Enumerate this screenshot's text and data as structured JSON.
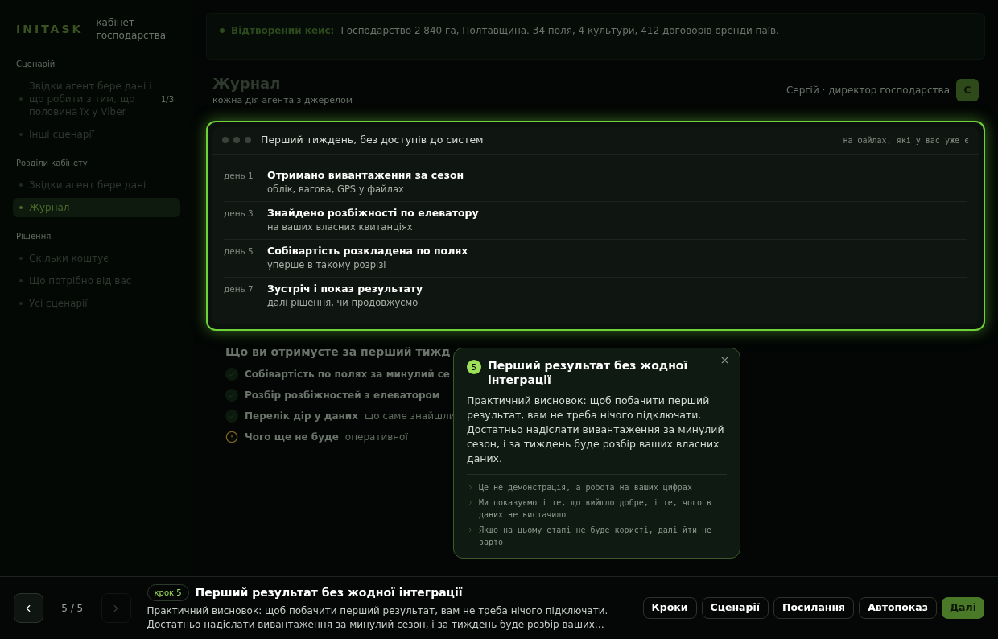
{
  "sidebar": {
    "logo": "INITASK",
    "subtitle": "кабінет господарства",
    "sections": [
      {
        "title": "Сценарій",
        "items": [
          {
            "label": "Звідки агент бере дані і що робити з тим, що половина їх у Viber",
            "count": "1/3",
            "selected": false
          },
          {
            "label": "Інші сценарії",
            "selected": false
          }
        ]
      },
      {
        "title": "Розділи кабінету",
        "items": [
          {
            "label": "Звідки агент бере дані",
            "selected": false
          },
          {
            "label": "Журнал",
            "selected": true
          }
        ]
      },
      {
        "title": "Рішення",
        "items": [
          {
            "label": "Скільки коштує",
            "selected": false
          },
          {
            "label": "Що потрібно від вас",
            "selected": false
          },
          {
            "label": "Усі сценарії",
            "selected": false
          }
        ]
      }
    ]
  },
  "banner": {
    "label": "Відтворений кейс:",
    "text": "Господарство 2 840 га, Полтавщина. 34 поля, 4 культури, 412 договорів оренди паїв."
  },
  "header": {
    "title": "Журнал",
    "subtitle": "кожна дія агента з джерелом",
    "user": "Сергій · директор господарства",
    "avatar": "С"
  },
  "timeline": {
    "title": "Перший тиждень, без доступів до систем",
    "note": "на файлах, які у вас уже є",
    "entries": [
      {
        "day": "день 1",
        "title": "Отримано вивантаження за сезон",
        "detail": "облік, вагова, GPS у файлах"
      },
      {
        "day": "день 3",
        "title": "Знайдено розбіжності по елеватору",
        "detail": "на ваших власних квитанціях"
      },
      {
        "day": "день 5",
        "title": "Собівартість розкладена по полях",
        "detail": "уперше в такому розрізі"
      },
      {
        "day": "день 7",
        "title": "Зустріч і показ результату",
        "detail": "далі рішення, чи продовжуємо"
      }
    ]
  },
  "deliverables": {
    "title": "Що ви отримуєте за перший тижд",
    "items": [
      {
        "kind": "check",
        "title": "Собівартість по полях за минулий се"
      },
      {
        "kind": "check",
        "title": "Розбір розбіжностей з елеватором"
      },
      {
        "kind": "check",
        "title": "Перелік дір у даних",
        "detail": "що саме знайшли"
      },
      {
        "kind": "warning",
        "title": "Чого ще не буде",
        "detail": "оперативної"
      }
    ]
  },
  "popover": {
    "step": "5",
    "title": "Перший результат без жодної інтеграції",
    "body": "Практичний висновок: щоб побачити перший результат, вам не треба нічого підключати. Достатньо надіслати вивантаження за минулий сезон, і за тиждень буде розбір ваших власних даних.",
    "points": [
      "Це не демонстрація, а робота на ваших цифрах",
      "Ми показуємо і те, що вийшло добре, і те, чого в даних не вистачило",
      "Якщо на цьому етапі не буде користі, далі йти не варто"
    ]
  },
  "footer": {
    "counter": "5 / 5",
    "prev_disabled": false,
    "next_disabled": true,
    "step_badge": "крок 5",
    "title": "Перший результат без жодної інтеграції",
    "description": "Практичний висновок: щоб побачити перший результат, вам не треба нічого підключати. Достатньо надіслати вивантаження за минулий сезон, і за тиждень буде розбір ваших…",
    "buttons": [
      {
        "label": "Кроки",
        "primary": false
      },
      {
        "label": "Сценарії",
        "primary": false
      },
      {
        "label": "Посилання",
        "primary": false
      },
      {
        "label": "Автопоказ",
        "primary": false
      },
      {
        "label": "Далі",
        "primary": true
      }
    ]
  }
}
